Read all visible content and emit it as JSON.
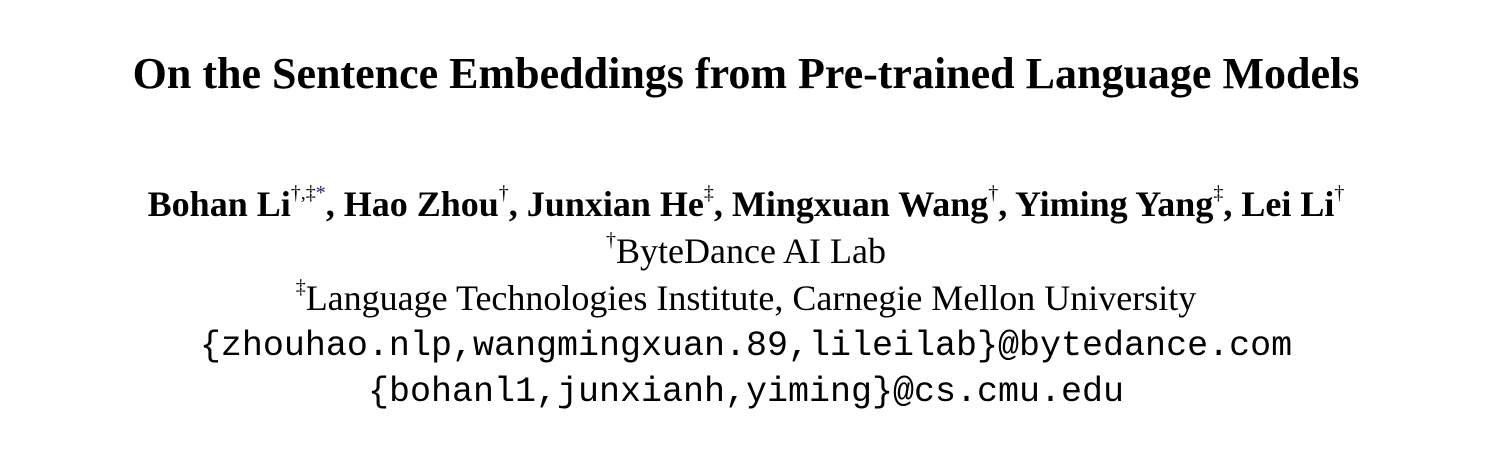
{
  "paper": {
    "title": "On the Sentence Embeddings from Pre-trained Language Models",
    "authors": [
      {
        "name": "Bohan Li",
        "marks": "†,‡",
        "star": "*"
      },
      {
        "name": "Hao Zhou",
        "marks": "†",
        "star": ""
      },
      {
        "name": "Junxian He",
        "marks": "‡",
        "star": ""
      },
      {
        "name": "Mingxuan Wang",
        "marks": "†",
        "star": ""
      },
      {
        "name": "Yiming Yang",
        "marks": "‡",
        "star": ""
      },
      {
        "name": "Lei Li",
        "marks": "†",
        "star": ""
      }
    ],
    "separator": ", ",
    "affiliations": [
      {
        "mark": "†",
        "text": "ByteDance AI Lab"
      },
      {
        "mark": "‡",
        "text": "Language Technologies Institute, Carnegie Mellon University"
      }
    ],
    "emails": [
      "{zhouhao.nlp,wangmingxuan.89,lileilab}@bytedance.com",
      "{bohanl1,junxianh,yiming}@cs.cmu.edu"
    ]
  }
}
